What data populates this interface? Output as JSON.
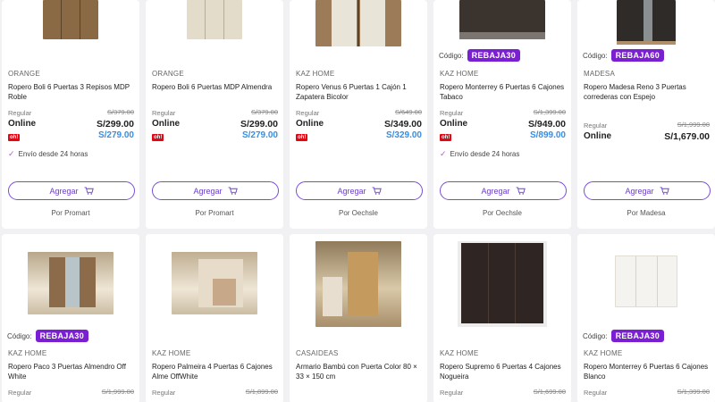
{
  "cards_row1": [
    {
      "brand": "ORANGE",
      "title": "Ropero Boli 6 Puertas 3 Repisos MDP Roble",
      "regular_label": "Regular",
      "regular_price": "S/379.00",
      "online_label": "Online",
      "online_price": "S/299.00",
      "card_price": "S/279.00",
      "oh_badge": "oh!",
      "shipping": "Envío desde 24 horas",
      "add_label": "Agregar",
      "seller": "Por Promart",
      "coupon": null
    },
    {
      "brand": "ORANGE",
      "title": "Ropero Boli 6 Puertas MDP Almendra",
      "regular_label": "Regular",
      "regular_price": "S/379.00",
      "online_label": "Online",
      "online_price": "S/299.00",
      "card_price": "S/279.00",
      "oh_badge": "oh!",
      "shipping": null,
      "add_label": "Agregar",
      "seller": "Por Promart",
      "coupon": null
    },
    {
      "brand": "KAZ HOME",
      "title": "Ropero Venus 6 Puertas 1 Cajón 1 Zapatera Bicolor",
      "regular_label": "Regular",
      "regular_price": "S/649.00",
      "online_label": "Online",
      "online_price": "S/349.00",
      "card_price": "S/329.00",
      "oh_badge": "oh!",
      "shipping": null,
      "add_label": "Agregar",
      "seller": "Por Oechsle",
      "coupon": null
    },
    {
      "brand": "KAZ HOME",
      "title": "Ropero Monterrey 6 Puertas 6 Cajones Tabaco",
      "regular_label": "Regular",
      "regular_price": "S/1,399.00",
      "online_label": "Online",
      "online_price": "S/949.00",
      "card_price": "S/899.00",
      "oh_badge": "oh!",
      "shipping": "Envío desde 24 horas",
      "add_label": "Agregar",
      "seller": "Por Oechsle",
      "coupon": {
        "label": "Código:",
        "code": "REBAJA30"
      }
    },
    {
      "brand": "MADESA",
      "title": "Ropero Madesa Reno 3 Puertas correderas con Espejo",
      "regular_label": "Regular",
      "regular_price": "S/1,999.00",
      "online_label": "Online",
      "online_price": "S/1,679.00",
      "card_price": null,
      "oh_badge": null,
      "shipping": null,
      "add_label": "Agregar",
      "seller": "Por Madesa",
      "coupon": {
        "label": "Código:",
        "code": "REBAJA60"
      }
    }
  ],
  "cards_row2": [
    {
      "coupon": {
        "label": "Código:",
        "code": "REBAJA30"
      },
      "brand": "KAZ HOME",
      "title": "Ropero Paco 3 Puertas Almendro Off White",
      "regular_label": "Regular",
      "regular_price": "S/1,999.00"
    },
    {
      "coupon": null,
      "brand": "KAZ HOME",
      "title": "Ropero Palmeira 4 Puertas 6 Cajones Alme OffWhite",
      "regular_label": "Regular",
      "regular_price": "S/1,899.00"
    },
    {
      "coupon": null,
      "brand": "CASAIDEAS",
      "title": "Armario Bambú con Puerta Color 80 × 33 × 150 cm",
      "regular_label": "",
      "regular_price": ""
    },
    {
      "coupon": null,
      "brand": "KAZ HOME",
      "title": "Ropero Supremo 6 Puertas 4 Cajones Nogueira",
      "regular_label": "Regular",
      "regular_price": "S/1,699.00"
    },
    {
      "coupon": {
        "label": "Código:",
        "code": "REBAJA30"
      },
      "brand": "KAZ HOME",
      "title": "Ropero Monterrey 6 Puertas 6 Cajones Blanco",
      "regular_label": "Regular",
      "regular_price": "S/1,399.00"
    }
  ],
  "colors": {
    "accent_purple": "#7a1fd1",
    "button_border": "#7a4bd8",
    "card_price_blue": "#3a8de0",
    "oh_red": "#e30613"
  },
  "icons": {
    "cart": "cart-icon",
    "check": "check-icon"
  }
}
